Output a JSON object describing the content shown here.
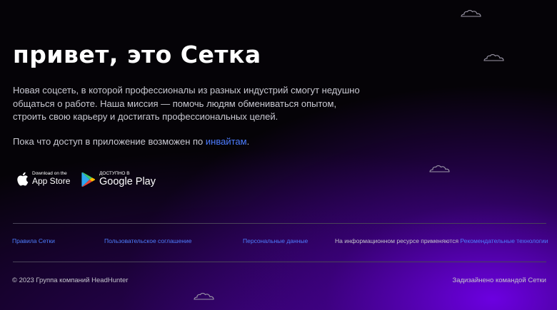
{
  "hero": {
    "title": "привет, это Сетка",
    "description": "Новая соцсеть, в которой профессионалы из разных индустрий смогут недушно общаться о работе. Наша миссия — помочь людям обмениваться опытом, строить свою карьеру и достигать профессиональных целей.",
    "invite_text": "Пока что доступ в приложение возможен по ",
    "invite_link": "инвайтам",
    "invite_end": "."
  },
  "stores": {
    "appstore": {
      "small": "Download on the",
      "big": "App Store",
      "icon": "apple-icon"
    },
    "googleplay": {
      "small": "ДОСТУПНО В",
      "big": "Google Play",
      "icon": "google-play-icon"
    }
  },
  "footer": {
    "links": [
      "Правила Сетки",
      "Пользовательское соглашение",
      "Персональные данные"
    ],
    "note_text": "На информационном ресурсе применяются ",
    "note_link": "Рекомендательные технологии",
    "copyright": "© 2023 Группа компаний HeadHunter",
    "made_by": "Задизайнено командой Сетки"
  },
  "colors": {
    "background": "#050307",
    "glow": "#7a00ff",
    "link": "#4d7dff",
    "text_muted": "#c9c9d2"
  }
}
